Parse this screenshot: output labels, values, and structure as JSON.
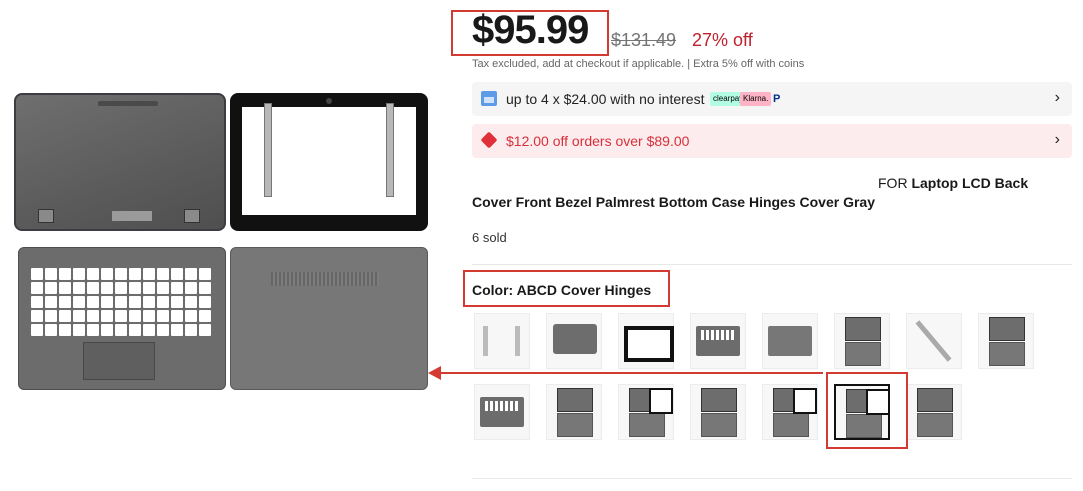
{
  "price": {
    "current": "$95.99",
    "original": "$131.49",
    "discount": "27% off",
    "tax_note": "Tax excluded, add at checkout if applicable.  |  Extra 5% off with coins"
  },
  "installment": {
    "text": "up to 4 x $24.00 with no interest",
    "badges": [
      "clearpay",
      "Klarna.",
      "P"
    ]
  },
  "coupon": {
    "text": "$12.00 off orders over $89.00"
  },
  "title": {
    "line1_prefix": "FOR ",
    "line1_bold": "Laptop LCD Back",
    "line2": "Cover Front Bezel Palmrest Bottom Case Hinges Cover Gray"
  },
  "sold": "6 sold",
  "color": {
    "label": "Color: ABCD Cover Hinges",
    "selected_index": 13,
    "variant_count": 15
  },
  "colors": {
    "accent": "#d33a32",
    "price_red": "#c0202e",
    "coupon_red": "#d6303a"
  },
  "icons": [
    "calendar-installment-icon",
    "coupon-tag-icon",
    "chevron-right-icon",
    "paypal-icon"
  ]
}
